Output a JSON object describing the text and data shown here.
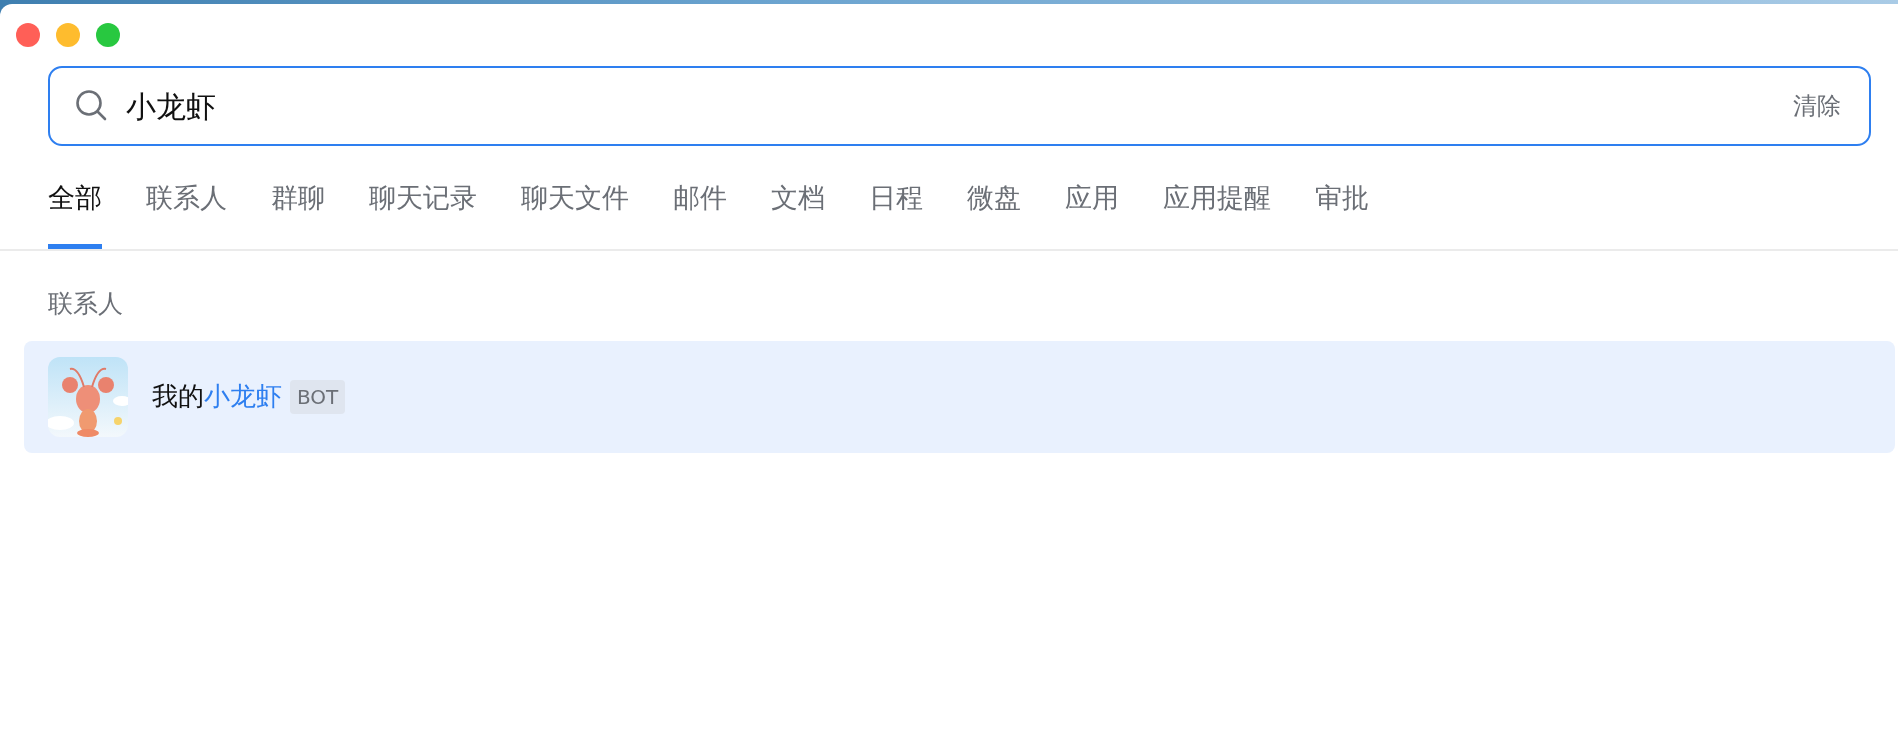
{
  "window": {
    "controls": [
      {
        "color": "#ff5f57"
      },
      {
        "color": "#febc2e"
      },
      {
        "color": "#28c840"
      }
    ]
  },
  "search": {
    "value": "小龙虾",
    "clear_label": "清除"
  },
  "tabs": [
    {
      "label": "全部",
      "selected": true
    },
    {
      "label": "联系人",
      "selected": false
    },
    {
      "label": "群聊",
      "selected": false
    },
    {
      "label": "聊天记录",
      "selected": false
    },
    {
      "label": "聊天文件",
      "selected": false
    },
    {
      "label": "邮件",
      "selected": false
    },
    {
      "label": "文档",
      "selected": false
    },
    {
      "label": "日程",
      "selected": false
    },
    {
      "label": "微盘",
      "selected": false
    },
    {
      "label": "应用",
      "selected": false
    },
    {
      "label": "应用提醒",
      "selected": false
    },
    {
      "label": "审批",
      "selected": false
    }
  ],
  "sections": [
    {
      "title": "联系人",
      "results": [
        {
          "name_parts": [
            {
              "text": "我的",
              "highlight": false
            },
            {
              "text": "小龙虾",
              "highlight": true
            }
          ],
          "badge": "BOT",
          "selected": true,
          "avatar": {
            "kind": "picture"
          }
        }
      ]
    }
  ]
}
